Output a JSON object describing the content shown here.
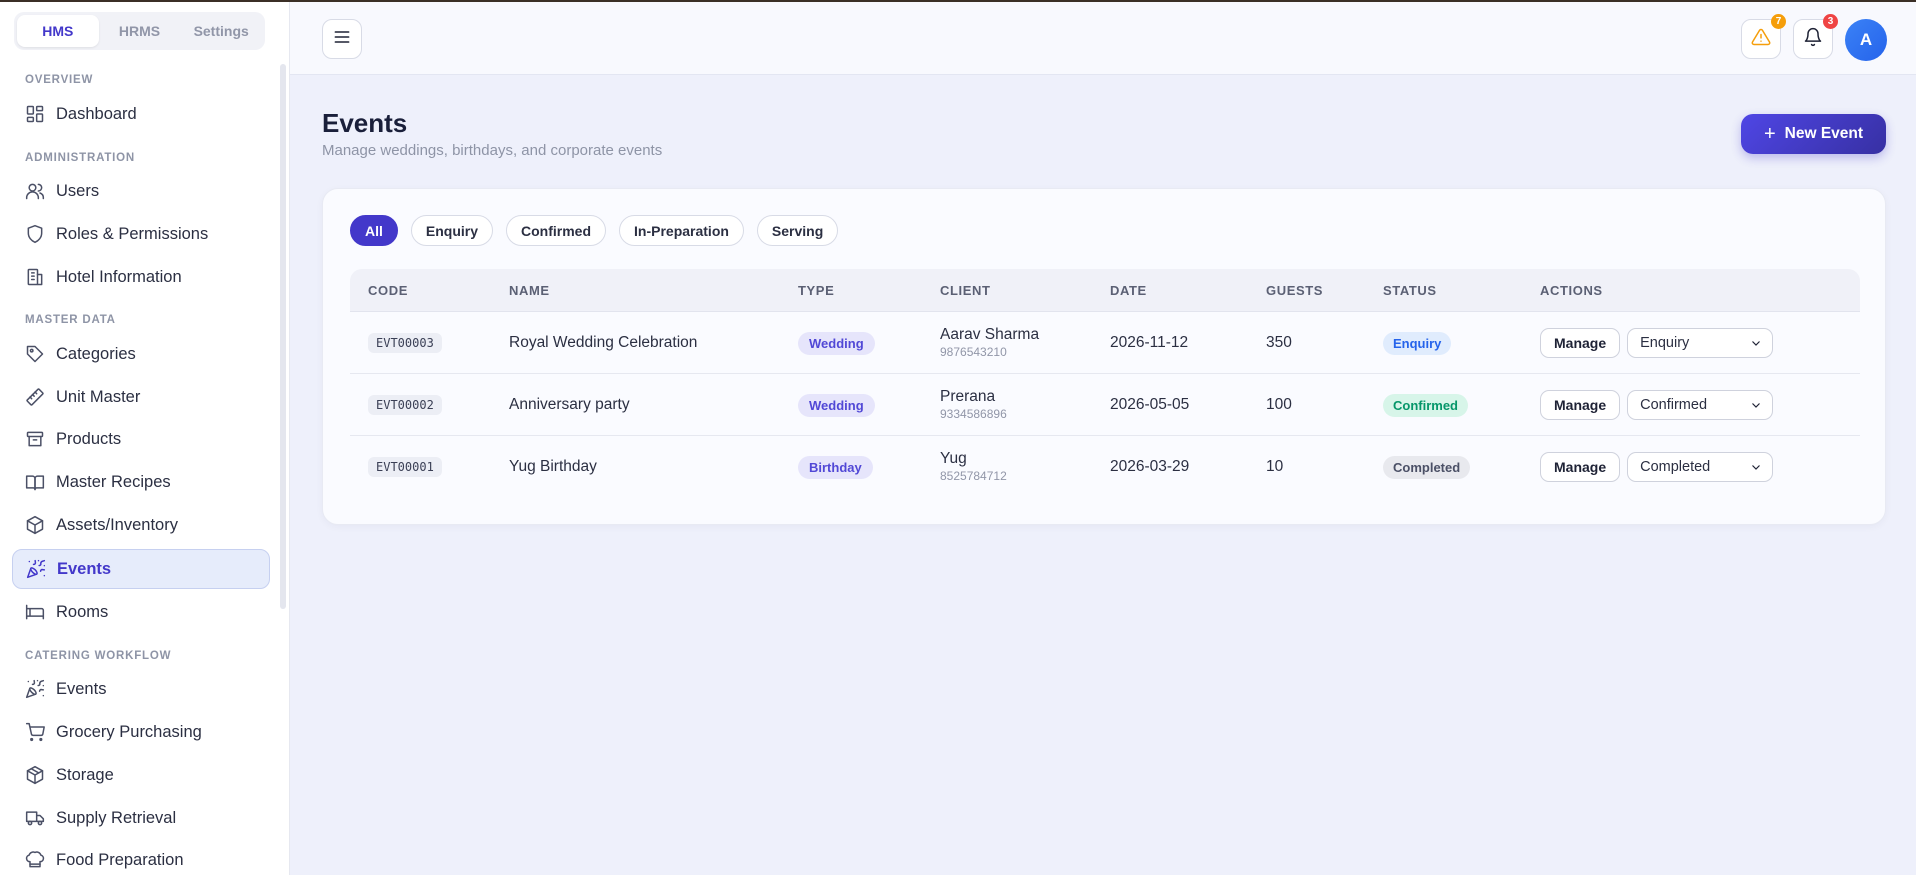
{
  "app_tabs": [
    {
      "label": "HMS",
      "active": true
    },
    {
      "label": "HRMS",
      "active": false
    },
    {
      "label": "Settings",
      "active": false
    }
  ],
  "sidebar": {
    "sections": [
      {
        "title": "Overview",
        "items": [
          {
            "label": "Dashboard",
            "icon": "dashboard-icon"
          }
        ]
      },
      {
        "title": "Administration",
        "items": [
          {
            "label": "Users",
            "icon": "users-icon"
          },
          {
            "label": "Roles & Permissions",
            "icon": "shield-icon"
          },
          {
            "label": "Hotel Information",
            "icon": "building-icon"
          }
        ]
      },
      {
        "title": "Master Data",
        "items": [
          {
            "label": "Categories",
            "icon": "tag-icon"
          },
          {
            "label": "Unit Master",
            "icon": "ruler-icon"
          },
          {
            "label": "Products",
            "icon": "archive-icon"
          },
          {
            "label": "Master Recipes",
            "icon": "book-icon"
          },
          {
            "label": "Assets/Inventory",
            "icon": "box-icon"
          },
          {
            "label": "Events",
            "icon": "party-icon",
            "active": true
          },
          {
            "label": "Rooms",
            "icon": "bed-icon"
          }
        ]
      },
      {
        "title": "Catering Workflow",
        "items": [
          {
            "label": "Events",
            "icon": "party-icon"
          },
          {
            "label": "Grocery Purchasing",
            "icon": "cart-icon"
          },
          {
            "label": "Storage",
            "icon": "package-icon"
          },
          {
            "label": "Supply Retrieval",
            "icon": "truck-icon"
          },
          {
            "label": "Food Preparation",
            "icon": "chef-hat-icon"
          }
        ]
      }
    ]
  },
  "topbar": {
    "menu_icon": "menu-icon",
    "alerts_count": "7",
    "notifications_count": "3",
    "avatar_initial": "A",
    "alerts_color": "#f59e0b",
    "notifications_color": "#ef4444"
  },
  "page": {
    "title": "Events",
    "subtitle": "Manage weddings, birthdays, and corporate events",
    "new_button": "New Event"
  },
  "filters": [
    {
      "label": "All",
      "active": true
    },
    {
      "label": "Enquiry"
    },
    {
      "label": "Confirmed"
    },
    {
      "label": "In-Preparation"
    },
    {
      "label": "Serving"
    }
  ],
  "table": {
    "columns": [
      "CODE",
      "NAME",
      "TYPE",
      "CLIENT",
      "DATE",
      "GUESTS",
      "STATUS",
      "ACTIONS"
    ],
    "rows": [
      {
        "code": "EVT00003",
        "name": "Royal Wedding Celebration",
        "type": "Wedding",
        "client": "Aarav Sharma",
        "phone": "9876543210",
        "date": "2026-11-12",
        "guests": "350",
        "status": "Enquiry",
        "status_class": "st-enquiry",
        "action": "Manage",
        "select_value": "Enquiry"
      },
      {
        "code": "EVT00002",
        "name": "Anniversary party",
        "type": "Wedding",
        "client": "Prerana",
        "phone": "9334586896",
        "date": "2026-05-05",
        "guests": "100",
        "status": "Confirmed",
        "status_class": "st-confirmed",
        "action": "Manage",
        "select_value": "Confirmed"
      },
      {
        "code": "EVT00001",
        "name": "Yug Birthday",
        "type": "Birthday",
        "client": "Yug",
        "phone": "8525784712",
        "date": "2026-03-29",
        "guests": "10",
        "status": "Completed",
        "status_class": "st-completed",
        "action": "Manage",
        "select_value": "Completed"
      }
    ]
  },
  "colors": {
    "accent": "#4338ca",
    "active_nav_bg": "#e6ecfb"
  }
}
